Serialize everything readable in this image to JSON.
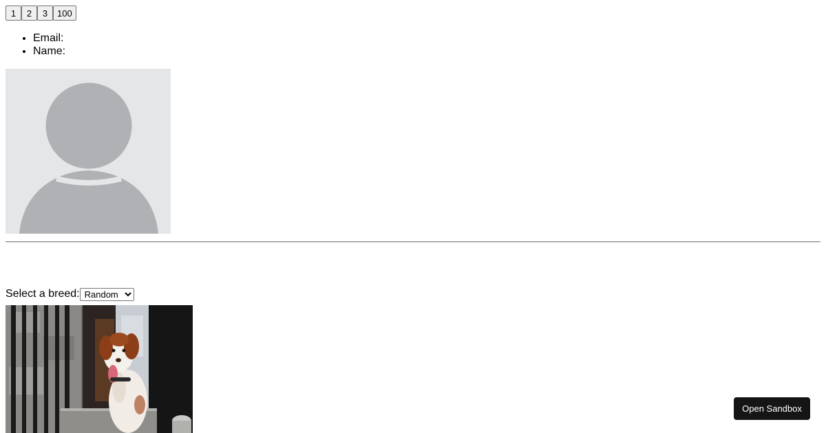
{
  "pagination": {
    "buttons": [
      "1",
      "2",
      "3",
      "100"
    ]
  },
  "user_info": {
    "email_label": "Email:",
    "name_label": "Name:"
  },
  "avatar": {
    "icon": "user-silhouette-icon",
    "bg_color": "#e5e6e8",
    "figure_color": "#b0b1b4"
  },
  "breed_selector": {
    "label": "Select a breed:",
    "selected": "Random"
  },
  "dog_image": {
    "subject": "brown-and-white dog photo"
  },
  "sandbox": {
    "button_label": "Open Sandbox",
    "bg_color": "#151515"
  }
}
